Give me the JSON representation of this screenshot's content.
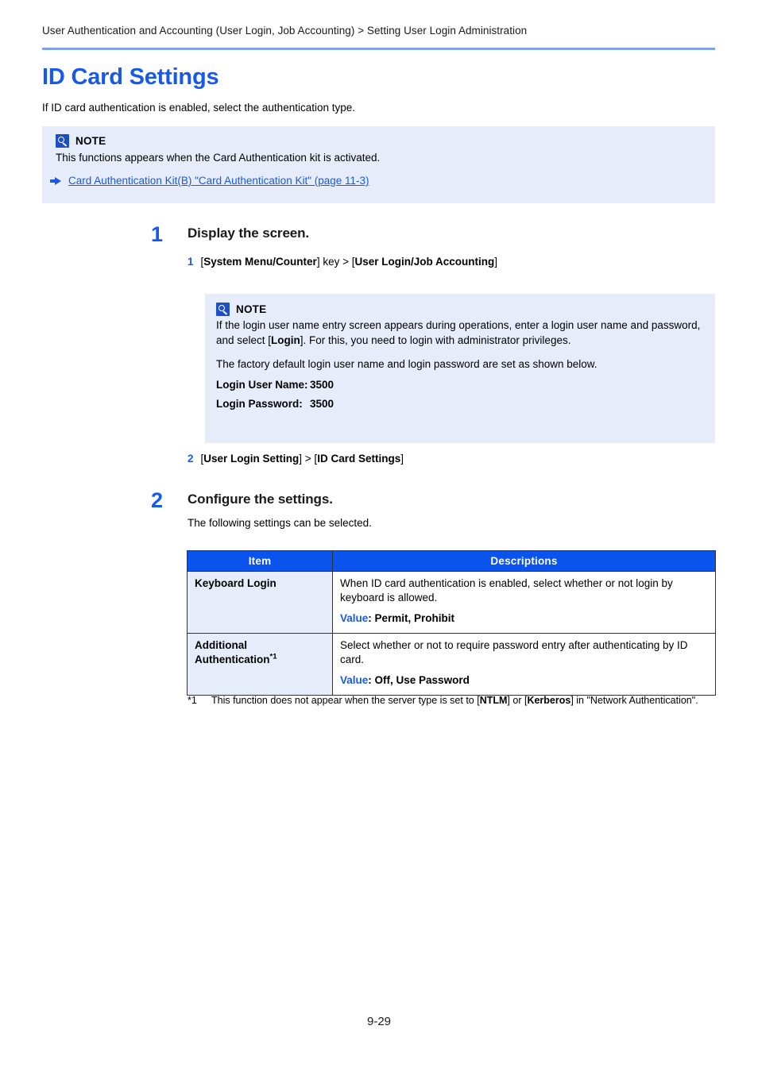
{
  "header": {
    "breadcrumb": "User Authentication and Accounting (User Login, Job Accounting) > Setting User Login Administration"
  },
  "title": "ID Card Settings",
  "intro": "If ID card authentication is enabled, select the authentication type.",
  "note_outer": {
    "label": "NOTE",
    "icon": "note-magnifier-icon",
    "text": "This functions appears when the Card Authentication kit is activated.",
    "link_icon": "arrow-right-icon",
    "link_text": "Card Authentication Kit(B) \"Card Authentication Kit\" (page 11-3)"
  },
  "steps": [
    {
      "number": "1",
      "title": "Display the screen.",
      "substeps": [
        {
          "number": "1",
          "prefix": "[",
          "bold1": "System Menu/Counter",
          "mid": "] key > [",
          "bold2": "User Login/Job Accounting",
          "suffix": "]"
        },
        {
          "number": "2",
          "prefix": "[",
          "bold1": "User Login Setting",
          "mid": "] > [",
          "bold2": "ID Card Settings",
          "suffix": "]"
        }
      ]
    },
    {
      "number": "2",
      "title": "Configure the settings.",
      "body": "The following settings can be selected."
    }
  ],
  "note_inner": {
    "label": "NOTE",
    "icon": "note-magnifier-icon",
    "text_part1": "If the login user name entry screen appears during operations, enter a login user name and password, and select [",
    "text_bold": "Login",
    "text_part2": "]. For this, you need to login with administrator privileges.",
    "text_second": "The factory default login user name and login password are set as shown below.",
    "credentials": [
      {
        "label": "Login User Name:",
        "value": "3500"
      },
      {
        "label": "Login Password:",
        "value": "3500"
      }
    ]
  },
  "table": {
    "headers": [
      "Item",
      "Descriptions"
    ],
    "rows": [
      {
        "item": "Keyboard Login",
        "item_sup": "",
        "description": "When ID card authentication is enabled, select whether or not login by keyboard is allowed.",
        "value_label": "Value",
        "value_text": ": Permit, Prohibit"
      },
      {
        "item": "Additional Authentication",
        "item_sup": "*1",
        "description": "Select whether or not to require password entry after authenticating by ID card.",
        "value_label": "Value",
        "value_text": ": Off, Use Password"
      }
    ]
  },
  "footnote": {
    "marker": "*1",
    "part1": "This function does not appear when the server type is set to [",
    "bold1": "NTLM",
    "mid": "] or [",
    "bold2": "Kerberos",
    "part2": "] in \"Network Authentication\"."
  },
  "footer": {
    "page_number": "9-29"
  },
  "colors": {
    "accent_blue": "#1759e8",
    "table_header_blue": "#0a53ec",
    "note_bg": "#e6ecfa",
    "rule_blue": "#7ba3ec"
  }
}
